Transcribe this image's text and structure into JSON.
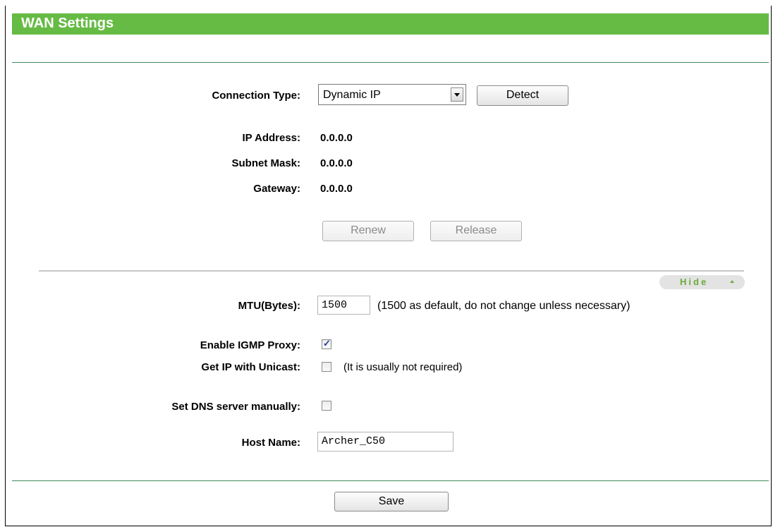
{
  "header": {
    "title": "WAN Settings"
  },
  "connection": {
    "type_label": "Connection Type:",
    "type_value": "Dynamic IP",
    "detect_label": "Detect"
  },
  "status": {
    "ip_label": "IP Address:",
    "ip_value": "0.0.0.0",
    "subnet_label": "Subnet Mask:",
    "subnet_value": "0.0.0.0",
    "gateway_label": "Gateway:",
    "gateway_value": "0.0.0.0",
    "renew_label": "Renew",
    "release_label": "Release"
  },
  "advanced": {
    "hide_label": "Hide",
    "mtu_label": "MTU(Bytes):",
    "mtu_value": "1500",
    "mtu_hint": "(1500 as default, do not change unless necessary)",
    "igmp_label": "Enable IGMP Proxy:",
    "igmp_checked": true,
    "unicast_label": "Get IP with Unicast:",
    "unicast_checked": false,
    "unicast_hint": "(It is usually not required)",
    "dns_label": "Set DNS server manually:",
    "dns_checked": false,
    "host_label": "Host Name:",
    "host_value": "Archer_C50"
  },
  "footer": {
    "save_label": "Save"
  },
  "colors": {
    "title_bar": "#66bb44",
    "divider": "#3f8a5a",
    "hide_text": "#6aaa3a"
  }
}
